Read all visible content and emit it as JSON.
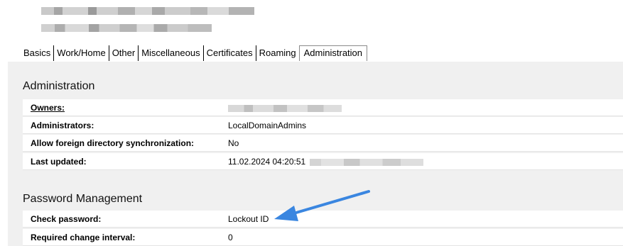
{
  "tabs": [
    {
      "label": "Basics",
      "active": false
    },
    {
      "label": "Work/Home",
      "active": false
    },
    {
      "label": "Other",
      "active": false
    },
    {
      "label": "Miscellaneous",
      "active": false
    },
    {
      "label": "Certificates",
      "active": false
    },
    {
      "label": "Roaming",
      "active": false
    },
    {
      "label": "Administration",
      "active": true
    }
  ],
  "sections": {
    "administration": {
      "title": "Administration",
      "rows": [
        {
          "label": "Owners:",
          "value": ""
        },
        {
          "label": "Administrators:",
          "value": "LocalDomainAdmins"
        },
        {
          "label": "Allow foreign directory synchronization:",
          "value": "No"
        },
        {
          "label": "Last updated:",
          "value": "11.02.2024 04:20:51"
        }
      ]
    },
    "password": {
      "title": "Password Management",
      "rows": [
        {
          "label": "Check password:",
          "value": "Lockout ID"
        },
        {
          "label": "Required change interval:",
          "value": "0"
        }
      ]
    }
  },
  "annotation": {
    "arrow_color": "#3a86e0"
  }
}
